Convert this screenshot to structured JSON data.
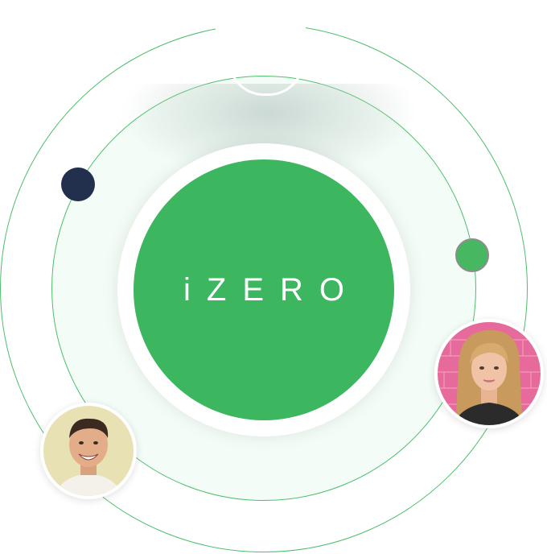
{
  "brand": {
    "logo_text": "iZERO"
  },
  "colors": {
    "primary_green": "#3db660",
    "orbit_line": "#4cbf6b",
    "navy": "#22304d",
    "inner_fill": "#f3fcf6"
  },
  "avatars": [
    {
      "name": "man-avatar",
      "icon": "person-photo"
    },
    {
      "name": "woman-avatar",
      "icon": "person-photo"
    }
  ]
}
